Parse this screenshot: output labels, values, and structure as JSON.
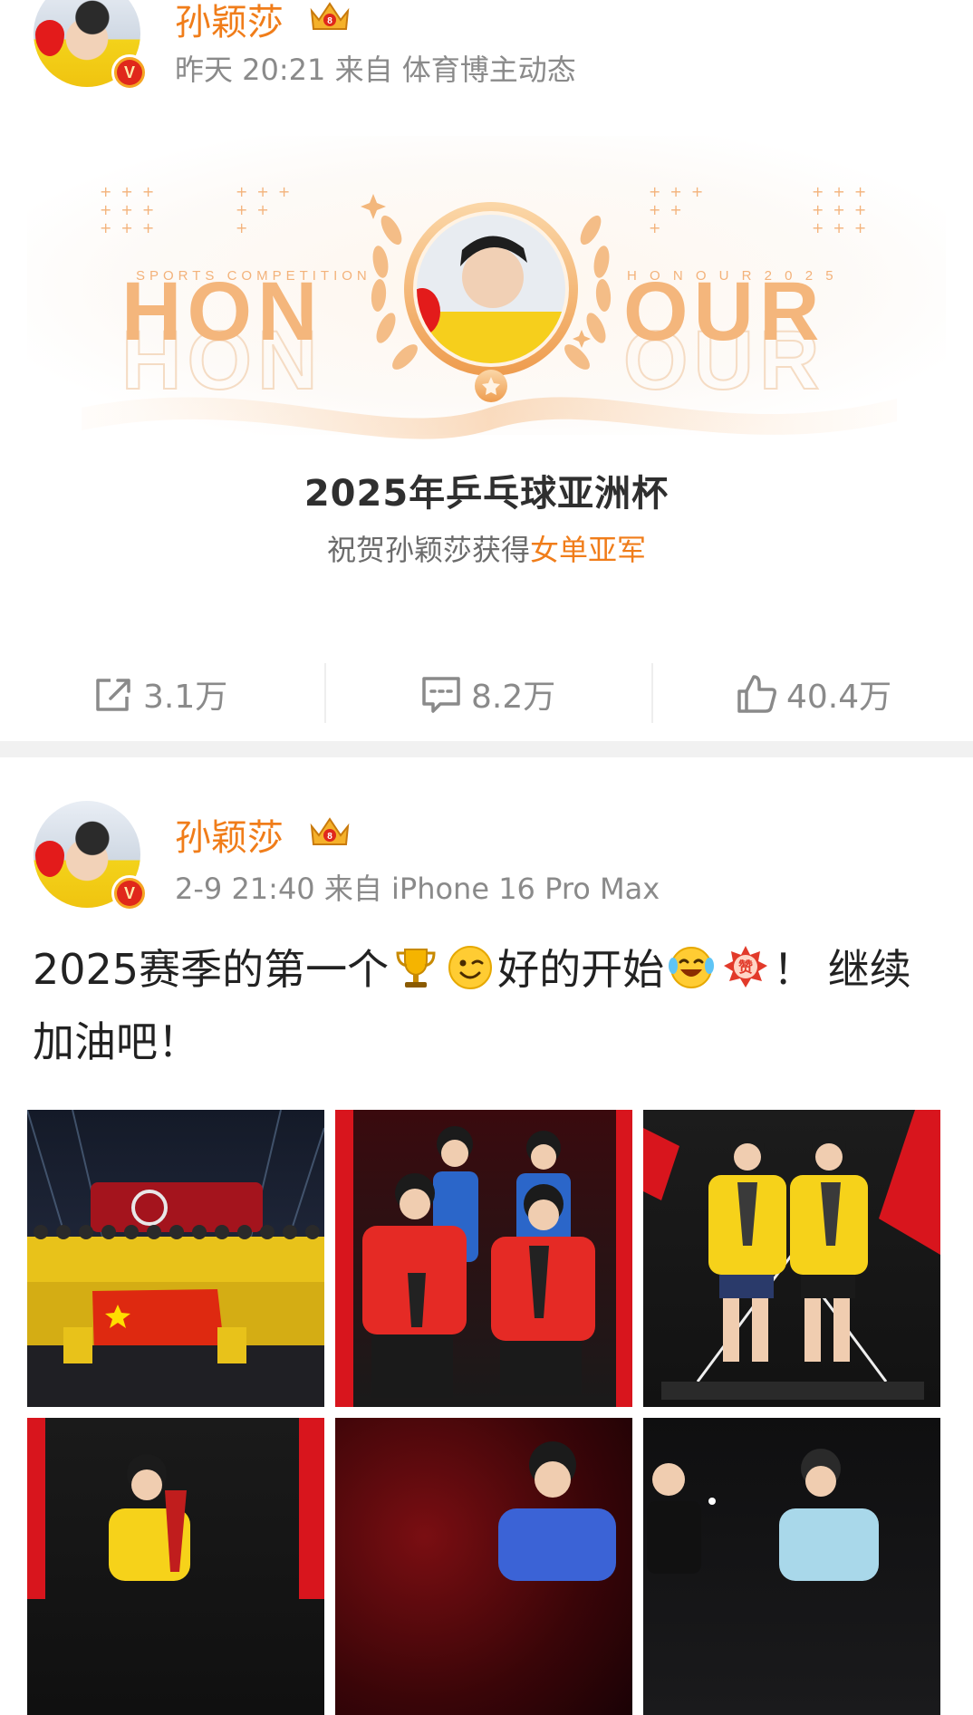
{
  "post1": {
    "username": "孙颖莎",
    "meta": "昨天 20:21 来自 体育博主动态",
    "card": {
      "tag_left": "SPORTS COMPETITION",
      "tag_right": "H O N O U R 2 0 2 5",
      "word_left": "HON",
      "word_right": "OUR",
      "title": "2025年乒乓球亚洲杯",
      "subtitle_prefix": "祝贺孙颖莎获得",
      "subtitle_highlight": "女单亚军"
    },
    "actions": {
      "share": "3.1万",
      "comment": "8.2万",
      "like": "40.4万"
    }
  },
  "post2": {
    "username": "孙颖莎",
    "meta": "2-9 21:40 来自 iPhone 16 Pro Max",
    "text_part1": "2025赛季的第一个",
    "text_part2": "好的开始",
    "text_part3": "！ 继续加油吧！",
    "emojis": [
      "trophy-icon",
      "wink-icon",
      "laugh-cry-icon",
      "zan-icon"
    ]
  },
  "colors": {
    "accent": "#f07d1a",
    "meta": "#8a8a8a",
    "honour": "#f4b67c"
  }
}
